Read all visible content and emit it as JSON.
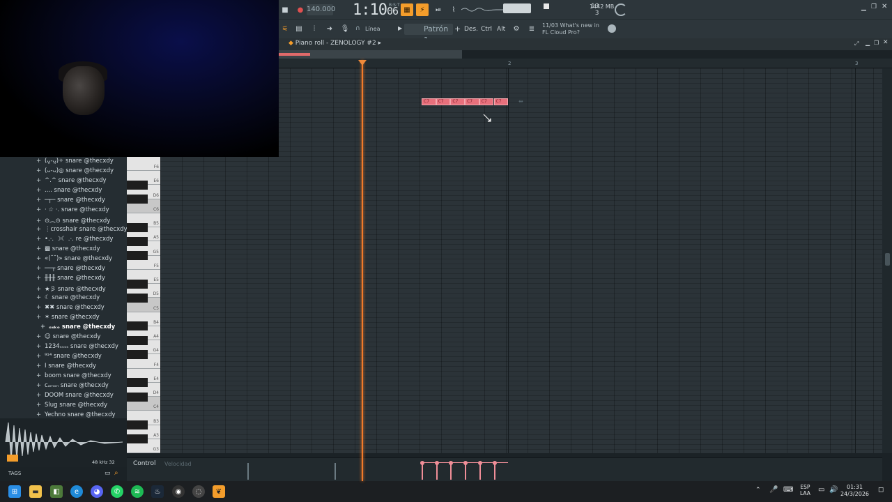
{
  "transport": {
    "tempo": "140.000",
    "song_position": "1:10",
    "song_position_small": "06",
    "bst_label": "B:S:T",
    "cpu_top": "13",
    "cpu_bottom": "3",
    "memory": "1442 MB"
  },
  "toolbar": {
    "line_label": "Línea",
    "pattern_label": "Patrón 1",
    "des_label": "Des.",
    "ctrl_label": "Ctrl",
    "alt_label": "Alt",
    "news_date": "11/03",
    "news_text": "What's new in FL Cloud Pro?"
  },
  "piano_roll": {
    "title": "Piano roll - ZENOLOGY #2",
    "ruler_marks": [
      "2",
      "3"
    ],
    "notes": [
      "C7",
      "C7",
      "C7",
      "C7",
      "C7",
      "C7"
    ],
    "control_label": "Control",
    "control_hint": "Velocidad"
  },
  "browser": {
    "items": [
      {
        "prefix": "(ᴗ̤-ᴗ̤)✧",
        "label": "snare @thecxdy"
      },
      {
        "prefix": "(ᴗ-ᴗ)◎",
        "label": "snare @thecxdy"
      },
      {
        "prefix": "^.^",
        "label": "snare @thecxdy"
      },
      {
        "prefix": "....",
        "label": "snare @thecxdy"
      },
      {
        "prefix": "─┬─",
        "label": "snare @thecxdy"
      },
      {
        "prefix": "· ☆ ·.",
        "label": "snare @thecxdy"
      },
      {
        "prefix": "⊙︵⊙",
        "label": "snare @thecxdy"
      },
      {
        "prefix": "⋮crosshair",
        "label": "snare @thecxdy"
      },
      {
        "prefix": "•.·. ☽☾ .·.",
        "label": "re @thecxdy"
      },
      {
        "prefix": "▩",
        "label": "snare @thecxdy"
      },
      {
        "prefix": "«(˘˘)»",
        "label": "snare @thecxdy"
      },
      {
        "prefix": "──┬",
        "label": "snare @thecxdy"
      },
      {
        "prefix": "╫╫╫",
        "label": "snare @thecxdy"
      },
      {
        "prefix": "★彡",
        "label": "snare @thecxdy"
      },
      {
        "prefix": "☾",
        "label": "snare @thecxdy"
      },
      {
        "prefix": "✖✖",
        "label": "snare @thecxdy"
      },
      {
        "prefix": "✶",
        "label": "snare @thecxdy"
      },
      {
        "prefix": "ₒₓₖₒ",
        "label": "snare @thecxdy"
      },
      {
        "prefix": "☺",
        "label": "snare @thecxdy"
      },
      {
        "prefix": "1234ₛₛₛₛ",
        "label": "snare @thecxdy"
      },
      {
        "prefix": "⁹¹⁴",
        "label": "snare @thecxdy"
      },
      {
        "prefix": "I",
        "label": "snare @thecxdy"
      },
      {
        "prefix": "boom",
        "label": "snare @thecxdy"
      },
      {
        "prefix": "cₐₘₒₙ",
        "label": "snare @thecxdy"
      },
      {
        "prefix": "DOOM",
        "label": "snare @thecxdy"
      },
      {
        "prefix": "Slug",
        "label": "snare @thecxdy"
      },
      {
        "prefix": "Yechno",
        "label": "snare @thecxdy"
      }
    ],
    "sample_rate": "48 kHz 32",
    "tags_label": "TAGS"
  },
  "keys": [
    "F6",
    "E6",
    "D6",
    "C6",
    "B5",
    "A5",
    "G5",
    "F5",
    "E5",
    "D5",
    "C5",
    "B4",
    "A4",
    "G4",
    "F4",
    "E4",
    "D4",
    "C4",
    "B3",
    "A3",
    "G3"
  ],
  "taskbar": {
    "language_top": "ESP",
    "language_bottom": "LAA",
    "time": "01:31",
    "date": "24/3/2026"
  },
  "colors": {
    "accent": "#f49d2b",
    "note": "#e8707c",
    "playhead": "#f17a2a"
  }
}
